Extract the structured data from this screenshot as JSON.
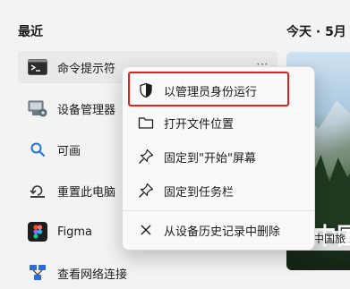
{
  "recent": {
    "title": "最近",
    "items": [
      {
        "label": "命令提示符"
      },
      {
        "label": "设备管理器"
      },
      {
        "label": "可画"
      },
      {
        "label": "重置此电脑"
      },
      {
        "label": "Figma"
      },
      {
        "label": "查看网络连接"
      }
    ]
  },
  "right_column": {
    "title": "今天 · 5月",
    "card": {
      "headline": "中国",
      "caption": "中国旅"
    }
  },
  "context_menu": {
    "items": [
      {
        "label": "以管理员身份运行"
      },
      {
        "label": "打开文件位置"
      },
      {
        "label": "固定到\"开始\"屏幕"
      },
      {
        "label": "固定到任务栏"
      },
      {
        "label": "从设备历史记录中删除"
      }
    ]
  },
  "icons": {
    "cmd": "command-prompt-icon",
    "device_manager": "device-manager-icon",
    "canva": "canva-search-icon",
    "reset_pc": "reset-pc-icon",
    "figma": "figma-icon",
    "network": "network-connections-icon",
    "admin": "shield-admin-icon",
    "folder": "folder-icon",
    "pin": "pin-icon",
    "close": "close-icon"
  },
  "colors": {
    "highlight": "#e3201b",
    "accent": "#0067c0"
  }
}
